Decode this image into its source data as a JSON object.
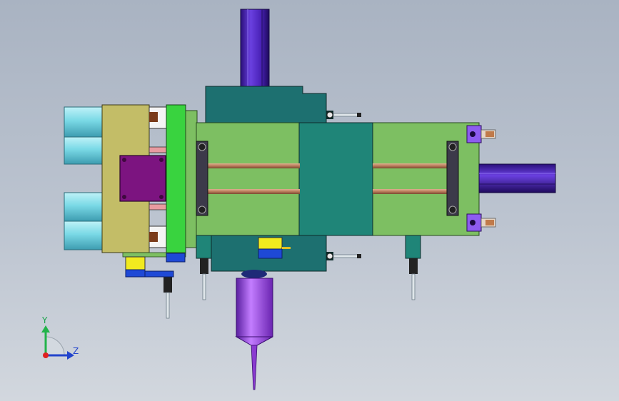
{
  "triad": {
    "y_label": "Y",
    "z_label": "Z"
  },
  "colors": {
    "body_green": "#7dbf62",
    "teal_block": "#1d7070",
    "center_plate": "#1f8578",
    "olive_plate": "#c3bd67",
    "bright_green_plate": "#39d33f",
    "purple_cylinder": "#4a22b8",
    "violet_cone": "#9b4fe8",
    "cyan_cylinder": "#7ad9e6",
    "magenta_plate": "#7c1480",
    "yellow_sensor": "#f1ea1f",
    "blue_bracket": "#1e49d6",
    "rod_copper": "#b87a5a"
  }
}
